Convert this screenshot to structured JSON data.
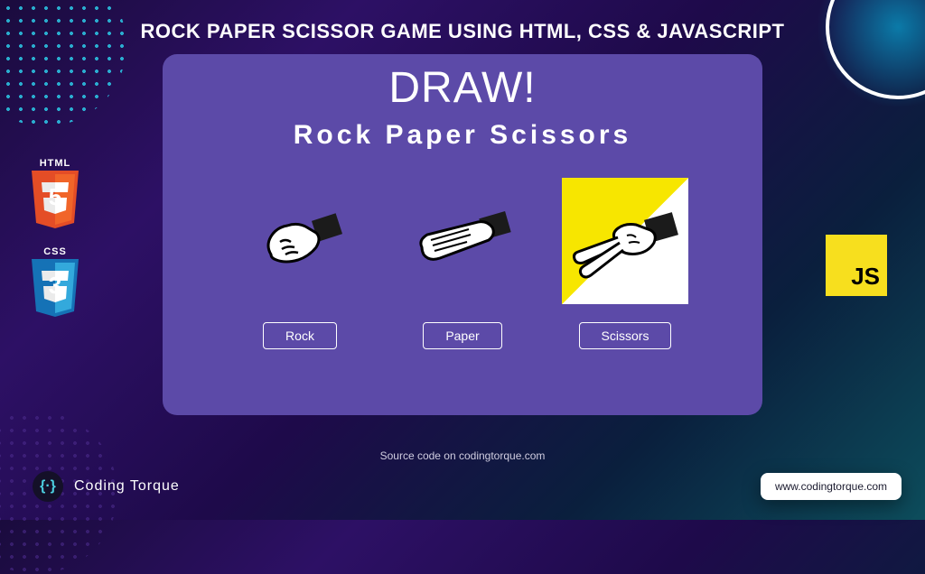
{
  "header": {
    "title": "ROCK PAPER SCISSOR GAME USING HTML, CSS & JAVASCRIPT"
  },
  "game": {
    "result": "DRAW!",
    "title": "Rock Paper Scissors",
    "choices": [
      {
        "label": "Rock",
        "highlighted": false
      },
      {
        "label": "Paper",
        "highlighted": false
      },
      {
        "label": "Scissors",
        "highlighted": true
      }
    ]
  },
  "logos": {
    "html_label": "HTML",
    "css_label": "CSS",
    "js_label": "JS"
  },
  "footer": {
    "source_text": "Source code on codingtorque.com",
    "brand_name": "Coding Torque",
    "url": "www.codingtorque.com"
  },
  "colors": {
    "card_bg": "#5c4aa8",
    "accent_yellow": "#f7e600",
    "html_orange": "#e44d26",
    "css_blue": "#1572b6",
    "js_yellow": "#f7df1e"
  }
}
